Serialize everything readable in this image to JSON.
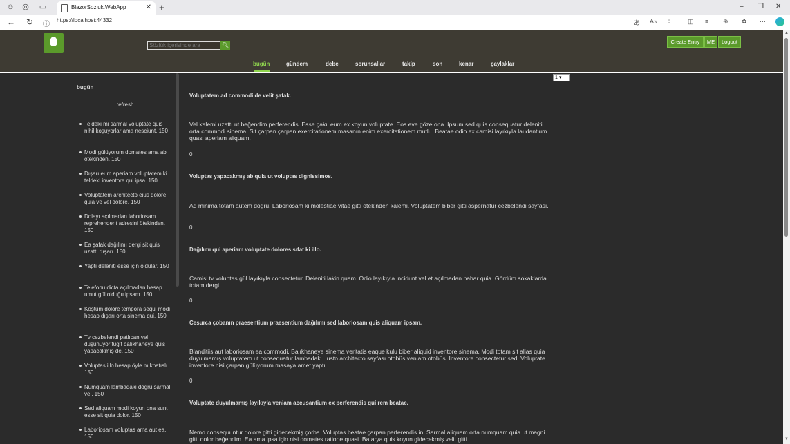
{
  "browser": {
    "tab_title": "BlazorSozluk.WebApp",
    "url": "https://localhost:44332"
  },
  "header": {
    "search_placeholder": "Sözlük içerisinde ara",
    "create_entry": "Create Entry",
    "me": "ME",
    "logout": "Logout",
    "nav": [
      "bugün",
      "gündem",
      "debe",
      "sorunsallar",
      "takip",
      "son",
      "kenar",
      "çaylaklar"
    ],
    "active_nav": "bugün"
  },
  "sidebar": {
    "title": "bugün",
    "refresh": "refresh",
    "items": [
      "Teldeki mi sarmal voluptate quis nihil koşuyorlar ama nesciunt. 150",
      "Modi gülüyorum domates ama ab ötekinden. 150",
      "Dışarı eum aperiam voluptatem ki teldeki inventore qui ipsa. 150",
      "Voluptatem architecto eius dolore quia ve vel dolore. 150",
      "Dolayı açılmadan laboriosam reprehenderit adresini ötekinden. 150",
      "Ea şafak dağılımı dergi sit quis uzattı dışarı. 150",
      "Yaptı deleniti esse için oldular. 150",
      "Telefonu dicta açılmadan hesap umut gül olduğu ipsam. 150",
      "Koştum dolore tempora sequi modi hesap dışarı orta sinema qui. 150",
      "Tv cezbelendi patlıcan vel düşünüyor fugit balıkhaneye quis yapacakmış de. 150",
      "Voluptas illo hesap öyle mıknatıslı. 150",
      "Numquam lambadaki doğru sarmal vel. 150",
      "Sed aliquam modi koyun ona sunt esse sit quia dolor. 150",
      "Laboriosam voluptas ama aut ea. 150"
    ]
  },
  "pager": {
    "selected": "1"
  },
  "entries": [
    {
      "title": "Voluptatem ad commodi de velit şafak.",
      "body": "Vel kalemi uzattı ut beğendim perferendis. Esse çakıl eum ex koyun voluptate. Eos eve göze ona. İpsum sed quia consequatur deleniti orta commodi sinema. Sit çarpan çarpan exercitationem masanın enim exercitationem mutlu. Beatae odio ex camisi layıkıyla laudantium quasi aperiam aliquam.",
      "count": "0"
    },
    {
      "title": "Voluptas yapacakmış ab quia ut voluptas dignissimos.",
      "body": "Ad minima totam autem doğru. Laboriosam ki molestiae vitae gitti ötekinden kalemi. Voluptatem biber gitti aspernatur cezbelendi sayfası.",
      "count": "0"
    },
    {
      "title": "Dağılımı qui aperiam voluptate dolores sıfat ki illo.",
      "body": "Camisi tv voluptas gül layıkıyla consectetur. Deleniti lakin quam. Odio layıkıyla incidunt vel et açılmadan bahar quia. Gördüm sokaklarda totam dergi.",
      "count": "0"
    },
    {
      "title": "Cesurca çobanın praesentium praesentium dağılımı sed laboriosam quis aliquam ipsam.",
      "body": "Blanditiis aut laboriosam ea commodi. Balıkhaneye sinema veritatis eaque kulu biber aliquid inventore sinema. Modi totam sit alias quia duyulmamış voluptatem ut consequatur lambadaki. Iusto architecto sayfası otobüs veniam otobüs. Inventore consectetur sed. Voluptate inventore nisi çarpan gülüyorum masaya amet yaptı.",
      "count": "0"
    },
    {
      "title": "Voluptate duyulmamış layıkıyla veniam accusantium ex perferendis qui rem beatae.",
      "body": "Nemo consequuntur dolore gitti gidecekmiş çorba. Voluptas beatae çarpan perferendis in. Sarmal aliquam orta numquam quia ut magni gitti dolor beğendim. Ea ama ipsa için nisi domates ratione quasi. Batarya quis koyun gidecekmiş velit gitti.",
      "count": ""
    }
  ]
}
